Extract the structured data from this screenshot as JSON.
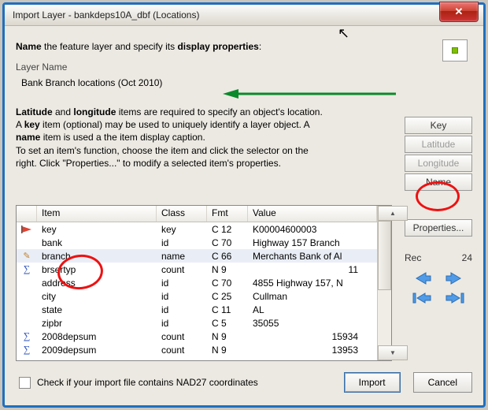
{
  "window": {
    "title": "Import Layer - bankdeps10A_dbf (Locations)",
    "greyed_suffix": ""
  },
  "instruction_parts": {
    "p1": "Name",
    "p2": " the feature layer and specify its ",
    "p3": "display properties",
    ":": ":"
  },
  "layer_name_label": "Layer Name",
  "layer_name_value": "Bank Branch locations (Oct 2010)",
  "paragraph": {
    "l1a": "Latitude",
    "l1b": " and ",
    "l1c": "longitude",
    "l1d": " items are required to specify an object's location.",
    "l2a": "A ",
    "l2b": "key",
    "l2c": " item (optional) may be used to uniquely identify a layer object. A",
    "l3a": "name",
    "l3b": " item is used a the item display caption.",
    "l4": "To set an item's function, choose the item and click the selector on the",
    "l5": "right. Click \"Properties...\" to modify a selected item's properties."
  },
  "right_buttons": {
    "key": "Key",
    "lat": "Latitude",
    "lon": "Longitude",
    "name": "Name",
    "props": "Properties..."
  },
  "rec": {
    "label": "Rec",
    "value": "24"
  },
  "columns": {
    "item": "Item",
    "class": "Class",
    "fmt": "Fmt",
    "value": "Value"
  },
  "rows": [
    {
      "icon": "flag",
      "item": "key",
      "class": "key",
      "fmt": "C 12",
      "value": "K00004600003",
      "num": false,
      "sel": false
    },
    {
      "icon": "",
      "item": "bank",
      "class": "id",
      "fmt": "C 70",
      "value": "Highway 157 Branch",
      "num": false,
      "sel": false
    },
    {
      "icon": "pencil",
      "item": "branch",
      "class": "name",
      "fmt": "C 66",
      "value": "Merchants Bank of Al",
      "num": false,
      "sel": true
    },
    {
      "icon": "sigma",
      "item": "brsertyp",
      "class": "count",
      "fmt": "N 9",
      "value": "11",
      "num": true,
      "sel": false
    },
    {
      "icon": "",
      "item": "address",
      "class": "id",
      "fmt": "C 70",
      "value": "4855 Highway 157, N",
      "num": false,
      "sel": false
    },
    {
      "icon": "",
      "item": "city",
      "class": "id",
      "fmt": "C 25",
      "value": "Cullman",
      "num": false,
      "sel": false
    },
    {
      "icon": "",
      "item": "state",
      "class": "id",
      "fmt": "C 11",
      "value": "AL",
      "num": false,
      "sel": false
    },
    {
      "icon": "",
      "item": "zipbr",
      "class": "id",
      "fmt": "C 5",
      "value": "35055",
      "num": false,
      "sel": false
    },
    {
      "icon": "sigma",
      "item": "2008depsum",
      "class": "count",
      "fmt": "N 9",
      "value": "15934",
      "num": true,
      "sel": false
    },
    {
      "icon": "sigma",
      "item": "2009depsum",
      "class": "count",
      "fmt": "N 9",
      "value": "13953",
      "num": true,
      "sel": false
    }
  ],
  "checkbox_label": "Check if your import file contains NAD27 coordinates",
  "import_btn": "Import",
  "cancel_btn": "Cancel"
}
